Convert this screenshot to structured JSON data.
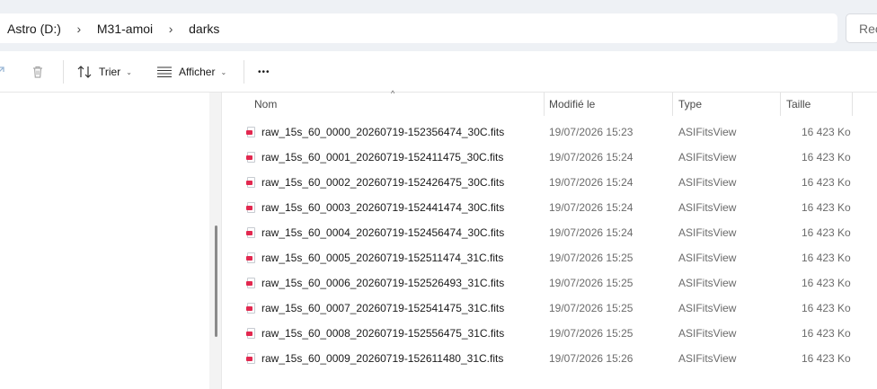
{
  "address": {
    "crumbs": [
      "Astro (D:)",
      "M31-amoi",
      "darks"
    ],
    "search_placeholder": "Rec"
  },
  "toolbar": {
    "sort_label": "Trier",
    "view_label": "Afficher",
    "more_label": "•••"
  },
  "columns": {
    "name": "Nom",
    "modified": "Modifié le",
    "type": "Type",
    "size": "Taille"
  },
  "files": [
    {
      "name": "raw_15s_60_0000_20260719-152356474_30C.fits",
      "modified": "19/07/2026 15:23",
      "type": "ASIFitsView",
      "size": "16 423 Ko"
    },
    {
      "name": "raw_15s_60_0001_20260719-152411475_30C.fits",
      "modified": "19/07/2026 15:24",
      "type": "ASIFitsView",
      "size": "16 423 Ko"
    },
    {
      "name": "raw_15s_60_0002_20260719-152426475_30C.fits",
      "modified": "19/07/2026 15:24",
      "type": "ASIFitsView",
      "size": "16 423 Ko"
    },
    {
      "name": "raw_15s_60_0003_20260719-152441474_30C.fits",
      "modified": "19/07/2026 15:24",
      "type": "ASIFitsView",
      "size": "16 423 Ko"
    },
    {
      "name": "raw_15s_60_0004_20260719-152456474_30C.fits",
      "modified": "19/07/2026 15:24",
      "type": "ASIFitsView",
      "size": "16 423 Ko"
    },
    {
      "name": "raw_15s_60_0005_20260719-152511474_31C.fits",
      "modified": "19/07/2026 15:25",
      "type": "ASIFitsView",
      "size": "16 423 Ko"
    },
    {
      "name": "raw_15s_60_0006_20260719-152526493_31C.fits",
      "modified": "19/07/2026 15:25",
      "type": "ASIFitsView",
      "size": "16 423 Ko"
    },
    {
      "name": "raw_15s_60_0007_20260719-152541475_31C.fits",
      "modified": "19/07/2026 15:25",
      "type": "ASIFitsView",
      "size": "16 423 Ko"
    },
    {
      "name": "raw_15s_60_0008_20260719-152556475_31C.fits",
      "modified": "19/07/2026 15:25",
      "type": "ASIFitsView",
      "size": "16 423 Ko"
    },
    {
      "name": "raw_15s_60_0009_20260719-152611480_31C.fits",
      "modified": "19/07/2026 15:26",
      "type": "ASIFitsView",
      "size": "16 423 Ko"
    }
  ],
  "icons": {
    "file_icon": "fits-file-icon",
    "file_icon_color": "#e2284f"
  }
}
